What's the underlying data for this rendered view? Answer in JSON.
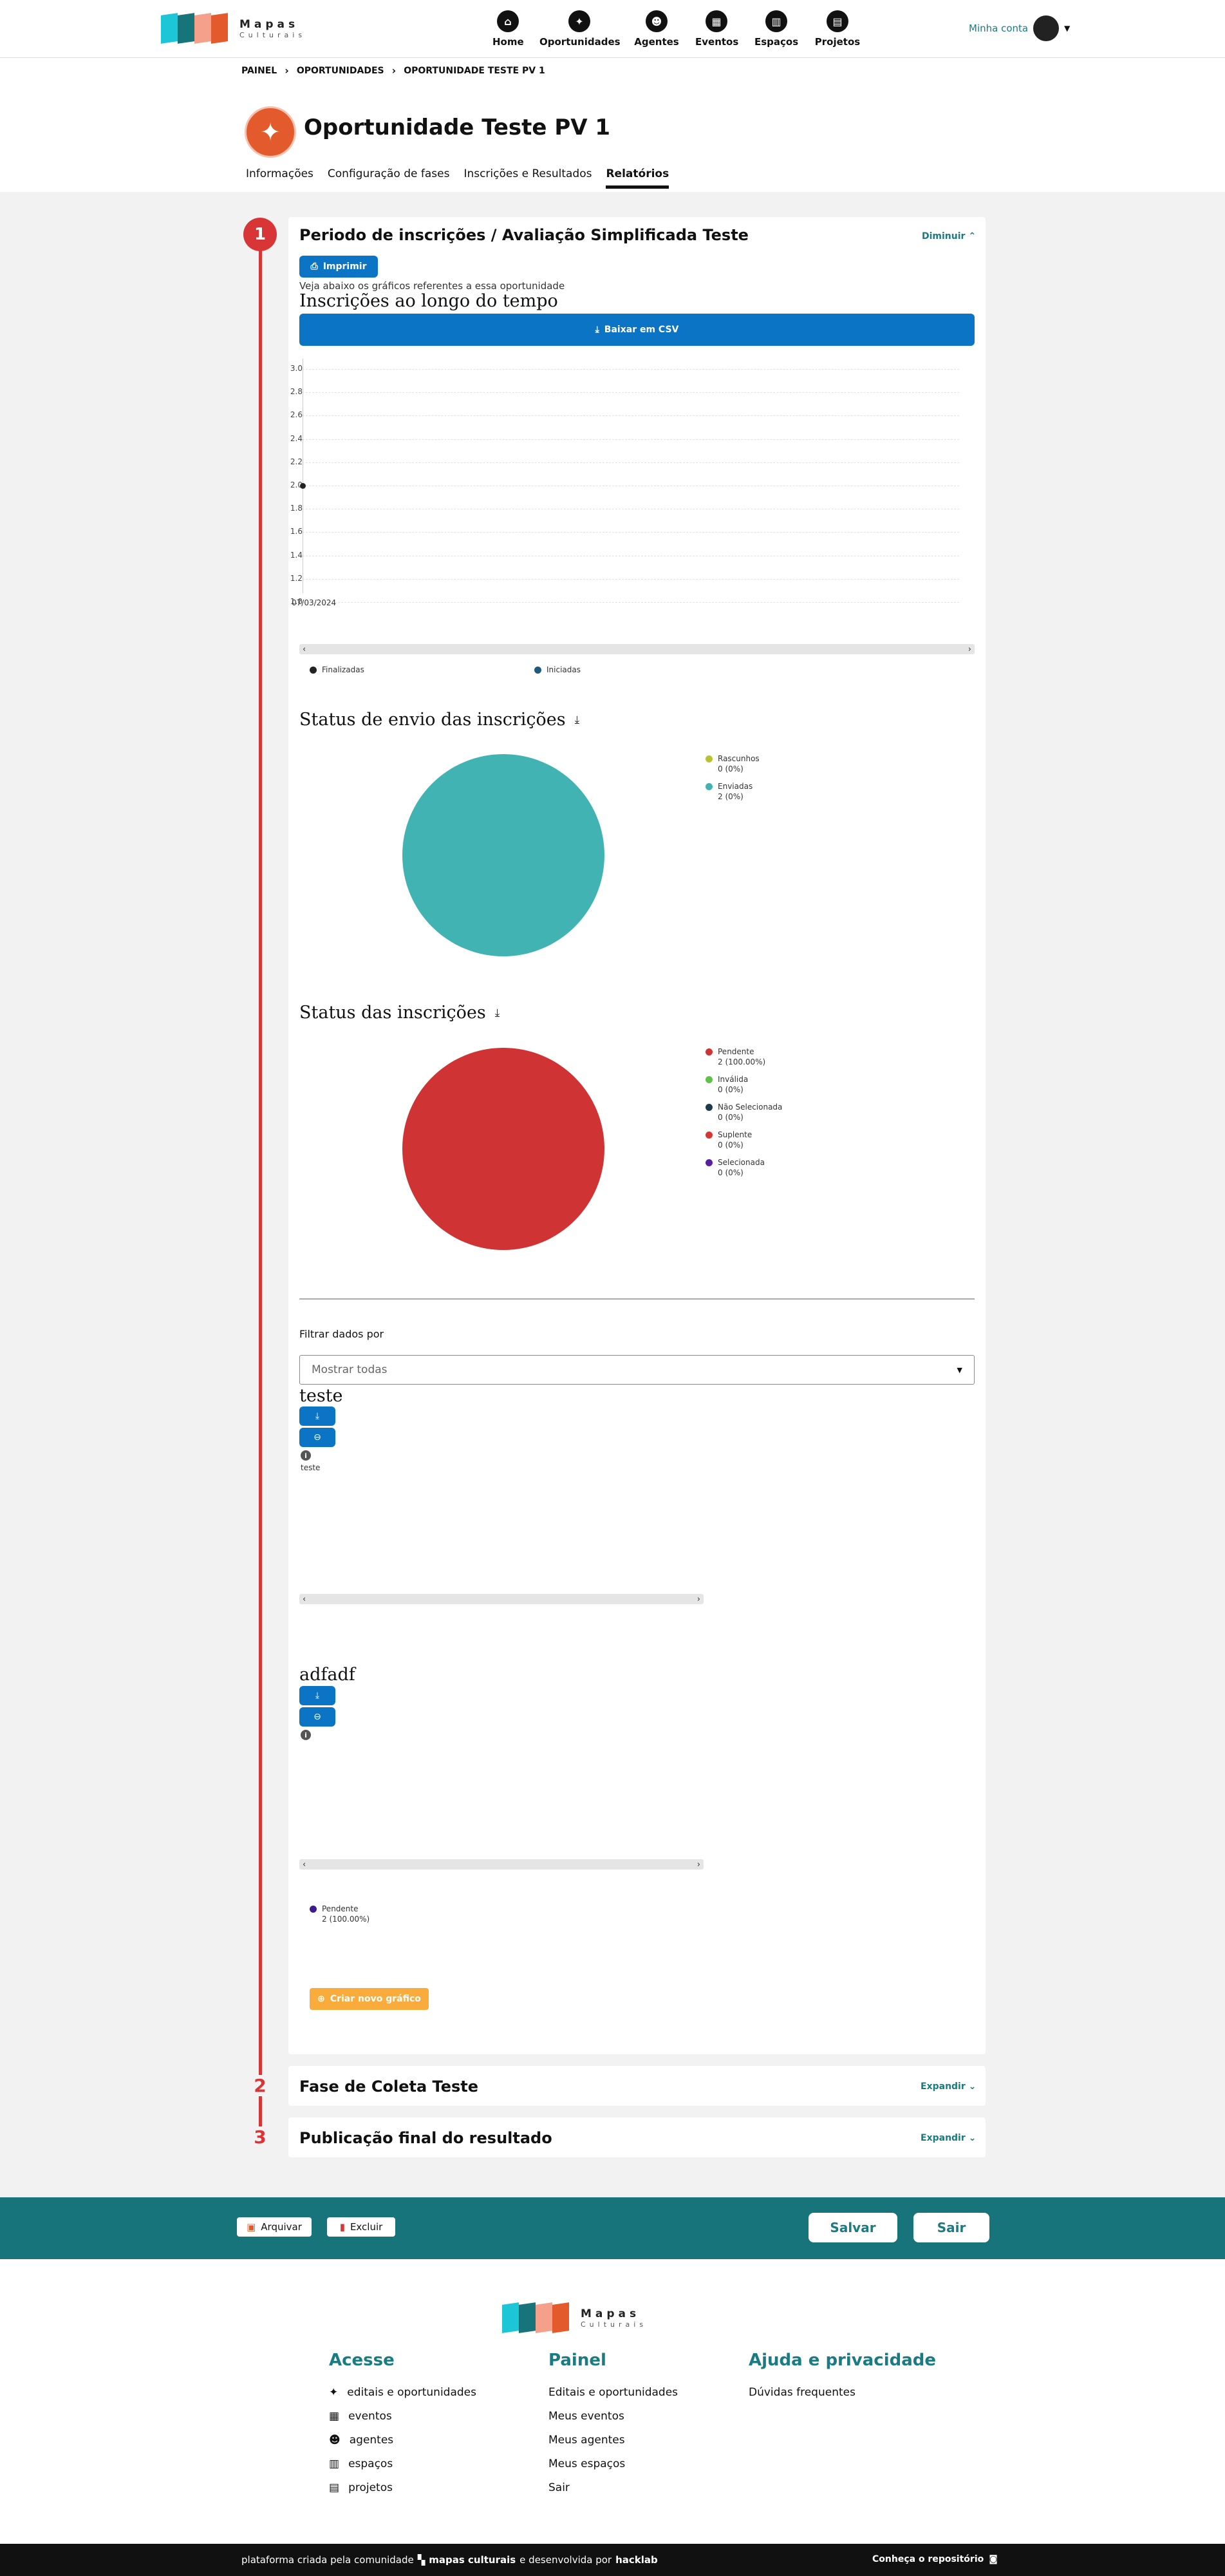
{
  "brand": {
    "name": "Mapas",
    "sub": "Culturais",
    "colors": [
      "#1dc6d6",
      "#e35b2c",
      "#16747a"
    ]
  },
  "nav": [
    {
      "label": "Home",
      "icon": "home-icon",
      "glyph": "⌂"
    },
    {
      "label": "Oportunidades",
      "icon": "lightbulb-icon",
      "glyph": "✦"
    },
    {
      "label": "Agentes",
      "icon": "users-icon",
      "glyph": "☻"
    },
    {
      "label": "Eventos",
      "icon": "calendar-icon",
      "glyph": "▦"
    },
    {
      "label": "Espaços",
      "icon": "building-icon",
      "glyph": "▥"
    },
    {
      "label": "Projetos",
      "icon": "clipboard-icon",
      "glyph": "▤"
    }
  ],
  "account": {
    "label": "Minha conta"
  },
  "breadcrumb": [
    "PAINEL",
    "OPORTUNIDADES",
    "OPORTUNIDADE TESTE PV 1"
  ],
  "page": {
    "title": "Oportunidade Teste PV 1"
  },
  "tabs": [
    "Informações",
    "Configuração de fases",
    "Inscrições e Resultados",
    "Relatórios"
  ],
  "phases": [
    {
      "number": "1",
      "title": "Periodo de inscrições / Avaliação Simplificada Teste",
      "toggle": "Diminuir ⌃"
    },
    {
      "number": "2",
      "title": "Fase de Coleta Teste",
      "toggle": "Expandir ⌄"
    },
    {
      "number": "3",
      "title": "Publicação final do resultado",
      "toggle": "Expandir ⌄"
    }
  ],
  "report": {
    "print_label": "Imprimir",
    "intro": "Veja abaixo os gráficos referentes a essa oportunidade",
    "timeline_title": "Inscrições ao longo do tempo",
    "csv_label": "Baixar em CSV",
    "submit_title": "Status de envio das inscrições",
    "status_title": "Status das inscrições",
    "filter_label": "Filtrar dados por",
    "filter_value": "Mostrar todas",
    "custom1_title": "teste",
    "custom1_legend": "teste",
    "custom2_title": "adfadf",
    "custom2_legend_label": "Pendente",
    "custom2_legend_value": "2 (100.00%)",
    "new_chart_label": "Criar novo gráfico"
  },
  "chart_data": [
    {
      "type": "line",
      "title": "Inscrições ao longo do tempo",
      "x": [
        "07/03/2024"
      ],
      "series": [
        {
          "name": "Finalizadas",
          "values": [
            2.0
          ],
          "color": "#222222"
        },
        {
          "name": "Iniciadas",
          "values": [
            2.0
          ],
          "color": "#1d5a7d"
        }
      ],
      "ylim": [
        1.0,
        3.0
      ],
      "yticks": [
        "3.0",
        "2.8",
        "2.6",
        "2.4",
        "2.2",
        "2.0",
        "1.8",
        "1.6",
        "1.4",
        "1.2",
        "1.0"
      ],
      "grid": true,
      "legend": "bottom"
    },
    {
      "type": "pie",
      "title": "Status de envio das inscrições",
      "categories": [
        "Rascunhos",
        "Enviadas"
      ],
      "labels": [
        "0 (0%)",
        "2 (0%)"
      ],
      "values": [
        0,
        2
      ],
      "colors": [
        "#b9c230",
        "#41b3b3"
      ],
      "legend": "right"
    },
    {
      "type": "pie",
      "title": "Status das inscrições",
      "categories": [
        "Pendente",
        "Inválida",
        "Não Selecionada",
        "Suplente",
        "Selecionada"
      ],
      "labels": [
        "2 (100.00%)",
        "0 (0%)",
        "0 (0%)",
        "0 (0%)",
        "0 (0%)"
      ],
      "values": [
        2,
        0,
        0,
        0,
        0
      ],
      "colors": [
        "#d03333",
        "#5ec24a",
        "#1c3b4d",
        "#d83636",
        "#5a1fa0"
      ],
      "legend": "right"
    }
  ],
  "actions": {
    "archive": "Arquivar",
    "delete": "Excluir",
    "save": "Salvar",
    "exit": "Sair"
  },
  "footer": {
    "access_title": "Acesse",
    "access": [
      "editais e oportunidades",
      "eventos",
      "agentes",
      "espaços",
      "projetos"
    ],
    "panel_title": "Painel",
    "panel": [
      "Editais e oportunidades",
      "Meus eventos",
      "Meus agentes",
      "Meus espaços",
      "Sair"
    ],
    "help_title": "Ajuda e privacidade",
    "help": [
      "Dúvidas frequentes"
    ],
    "credit_1": "plataforma criada pela comunidade",
    "credit_brand": "mapas culturais",
    "credit_2": "e desenvolvida por",
    "credit_dev": "hacklab",
    "repo": "Conheça o repositório"
  }
}
